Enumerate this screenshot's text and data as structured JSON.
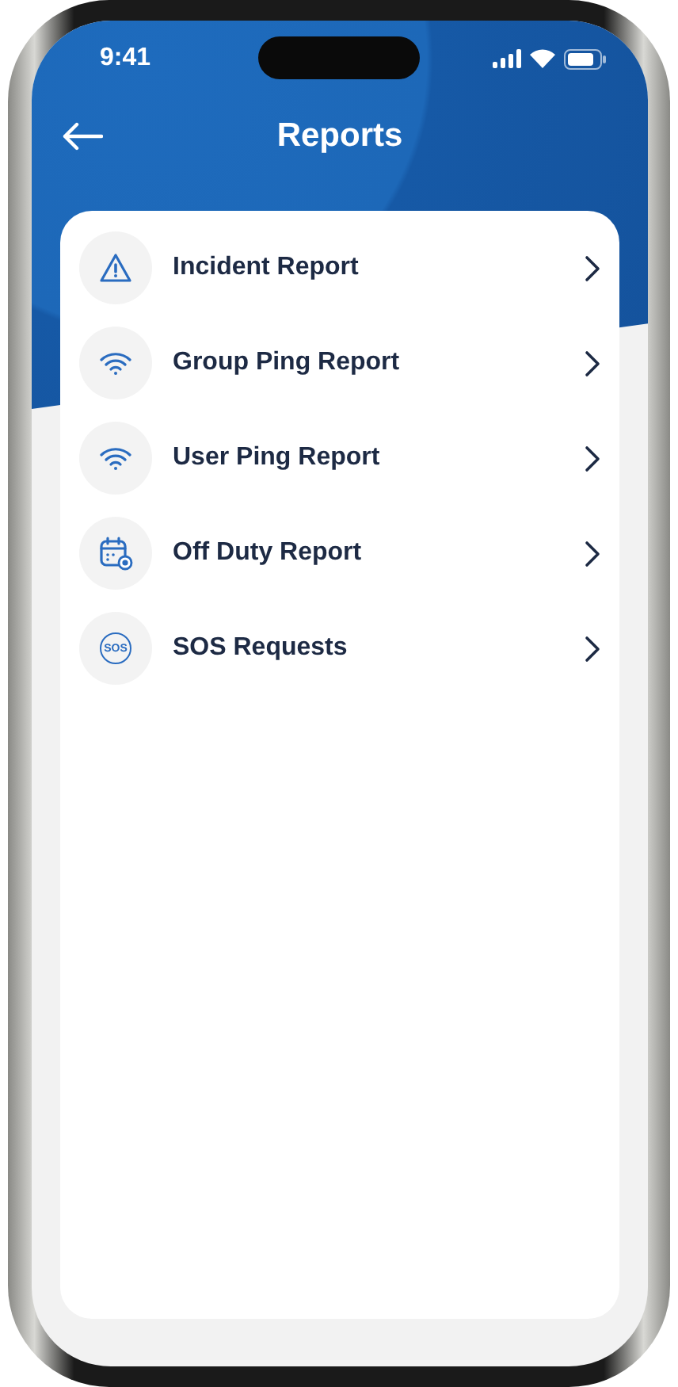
{
  "status_bar": {
    "time": "9:41"
  },
  "header": {
    "title": "Reports"
  },
  "items": [
    {
      "kind": "warning",
      "label": "Incident Report"
    },
    {
      "kind": "wifi",
      "label": "Group Ping Report"
    },
    {
      "kind": "wifi",
      "label": "User Ping Report"
    },
    {
      "kind": "calendar",
      "label": "Off Duty Report"
    },
    {
      "kind": "sos",
      "label": "SOS Requests",
      "icon_text": "SOS"
    }
  ]
}
